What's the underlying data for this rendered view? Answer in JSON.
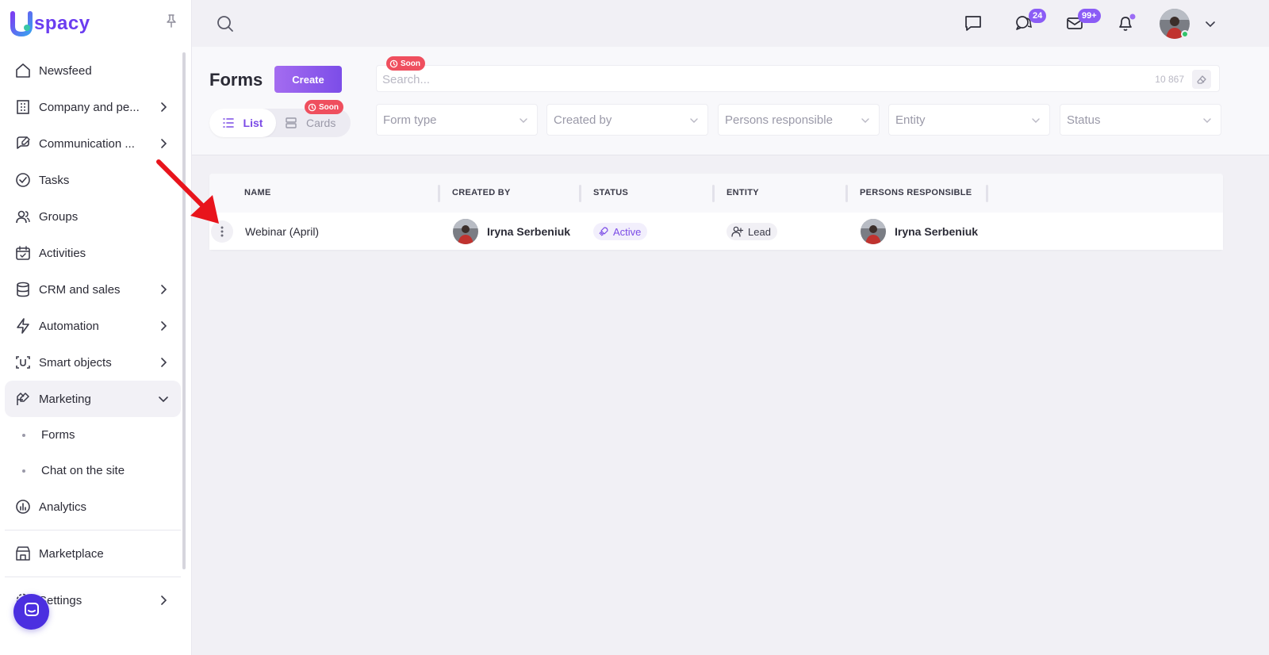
{
  "brand": {
    "name": "spacy",
    "accent": "#7c4de8"
  },
  "sidebar": {
    "items": [
      {
        "label": "Newsfeed",
        "icon": "home-icon",
        "chevron": false
      },
      {
        "label": "Company and pe...",
        "icon": "building-icon",
        "chevron": true
      },
      {
        "label": "Communication ...",
        "icon": "chat-edit-icon",
        "chevron": true
      },
      {
        "label": "Tasks",
        "icon": "check-circle-icon",
        "chevron": false
      },
      {
        "label": "Groups",
        "icon": "users-icon",
        "chevron": false
      },
      {
        "label": "Activities",
        "icon": "calendar-icon",
        "chevron": false
      },
      {
        "label": "CRM and sales",
        "icon": "database-icon",
        "chevron": true
      },
      {
        "label": "Automation",
        "icon": "lightning-icon",
        "chevron": true
      },
      {
        "label": "Smart objects",
        "icon": "smart-object-icon",
        "chevron": true
      },
      {
        "label": "Marketing",
        "icon": "megaphone-icon",
        "chevron": true,
        "expanded": true
      }
    ],
    "marketing_sub": [
      "Forms",
      "Chat on the site"
    ],
    "analytics": "Analytics",
    "marketplace": "Marketplace",
    "settings": "Settings"
  },
  "topbar": {
    "chat_badge": "24",
    "mail_badge": "99+"
  },
  "page": {
    "title": "Forms",
    "create_label": "Create",
    "soon_label": "Soon",
    "view_list": "List",
    "view_cards": "Cards",
    "search_placeholder": "Search...",
    "search_count": "10 867",
    "filters": [
      "Form type",
      "Created by",
      "Persons responsible",
      "Entity",
      "Status"
    ]
  },
  "table": {
    "headers": [
      "NAME",
      "CREATED BY",
      "STATUS",
      "ENTITY",
      "PERSONS RESPONSIBLE"
    ],
    "rows": [
      {
        "name": "Webinar (April)",
        "created_by": "Iryna Serbeniuk",
        "status": "Active",
        "entity": "Lead",
        "responsible": "Iryna Serbeniuk"
      }
    ]
  }
}
